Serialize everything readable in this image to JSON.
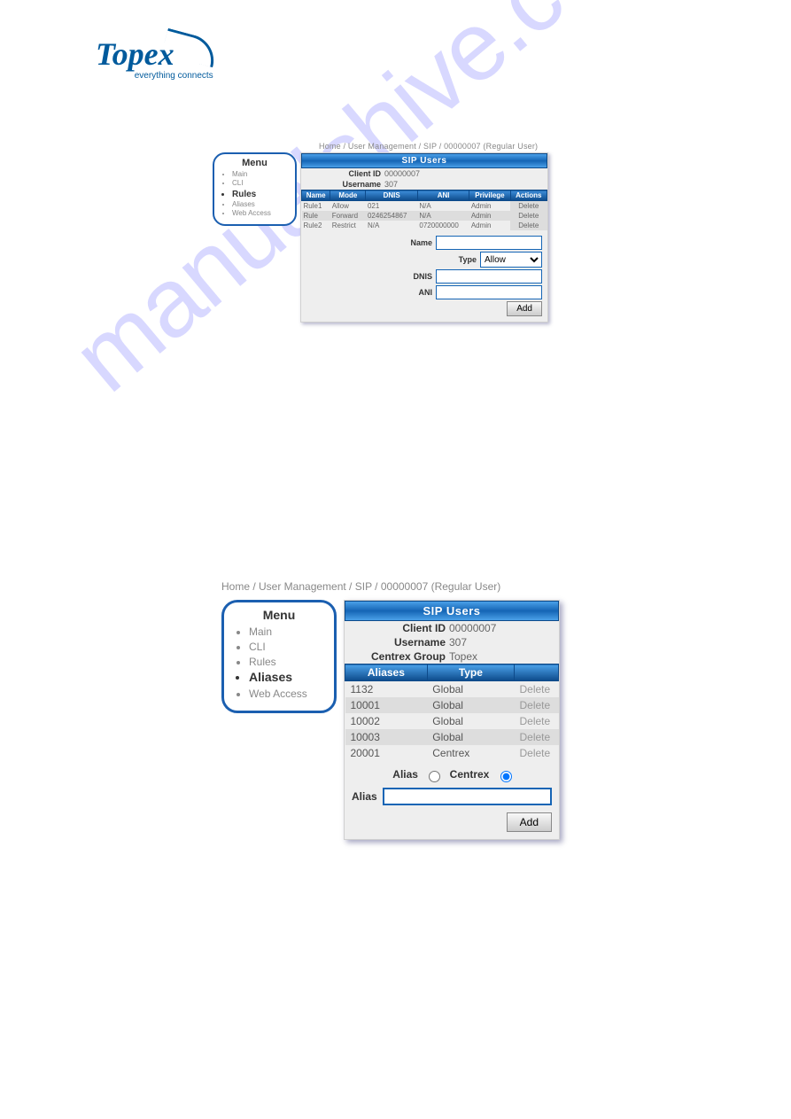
{
  "logo": {
    "brand": "Topex",
    "tagline": "everything connects"
  },
  "watermark": "manualshive.com",
  "section1": {
    "breadcrumb": "Home / User Management / SIP / 00000007  (Regular User)",
    "menu": {
      "title": "Menu",
      "items": [
        "Main",
        "CLI",
        "Rules",
        "Aliases",
        "Web Access"
      ],
      "active_index": 2
    },
    "panel_title": "SIP Users",
    "client_id_label": "Client ID",
    "client_id": "00000007",
    "username_label": "Username",
    "username": "307",
    "columns": [
      "Name",
      "Mode",
      "DNIS",
      "ANI",
      "Privilege",
      "Actions"
    ],
    "rows": [
      {
        "name": "Rule1",
        "mode": "Allow",
        "dnis": "021",
        "ani": "N/A",
        "priv": "Admin",
        "action": "Delete"
      },
      {
        "name": "Rule",
        "mode": "Forward",
        "dnis": "0246254867",
        "ani": "N/A",
        "priv": "Admin",
        "action": "Delete"
      },
      {
        "name": "Rule2",
        "mode": "Restrict",
        "dnis": "N/A",
        "ani": "0720000000",
        "priv": "Admin",
        "action": "Delete"
      }
    ],
    "form": {
      "name_label": "Name",
      "type_label": "Type",
      "type_value": "Allow",
      "dnis_label": "DNIS",
      "ani_label": "ANI",
      "add_label": "Add"
    }
  },
  "section2": {
    "breadcrumb": "Home / User Management / SIP / 00000007  (Regular User)",
    "menu": {
      "title": "Menu",
      "items": [
        "Main",
        "CLI",
        "Rules",
        "Aliases",
        "Web Access"
      ],
      "active_index": 3
    },
    "panel_title": "SIP Users",
    "client_id_label": "Client ID",
    "client_id": "00000007",
    "username_label": "Username",
    "username": "307",
    "centrex_label": "Centrex Group",
    "centrex_value": "Topex",
    "columns": [
      "Aliases",
      "Type",
      ""
    ],
    "rows": [
      {
        "alias": "1132",
        "type": "Global",
        "action": "Delete"
      },
      {
        "alias": "10001",
        "type": "Global",
        "action": "Delete"
      },
      {
        "alias": "10002",
        "type": "Global",
        "action": "Delete"
      },
      {
        "alias": "10003",
        "type": "Global",
        "action": "Delete"
      },
      {
        "alias": "20001",
        "type": "Centrex",
        "action": "Delete"
      }
    ],
    "radios": {
      "alias_label": "Alias",
      "centrex_label": "Centrex",
      "selected": "centrex"
    },
    "form": {
      "alias_label": "Alias",
      "add_label": "Add"
    }
  }
}
